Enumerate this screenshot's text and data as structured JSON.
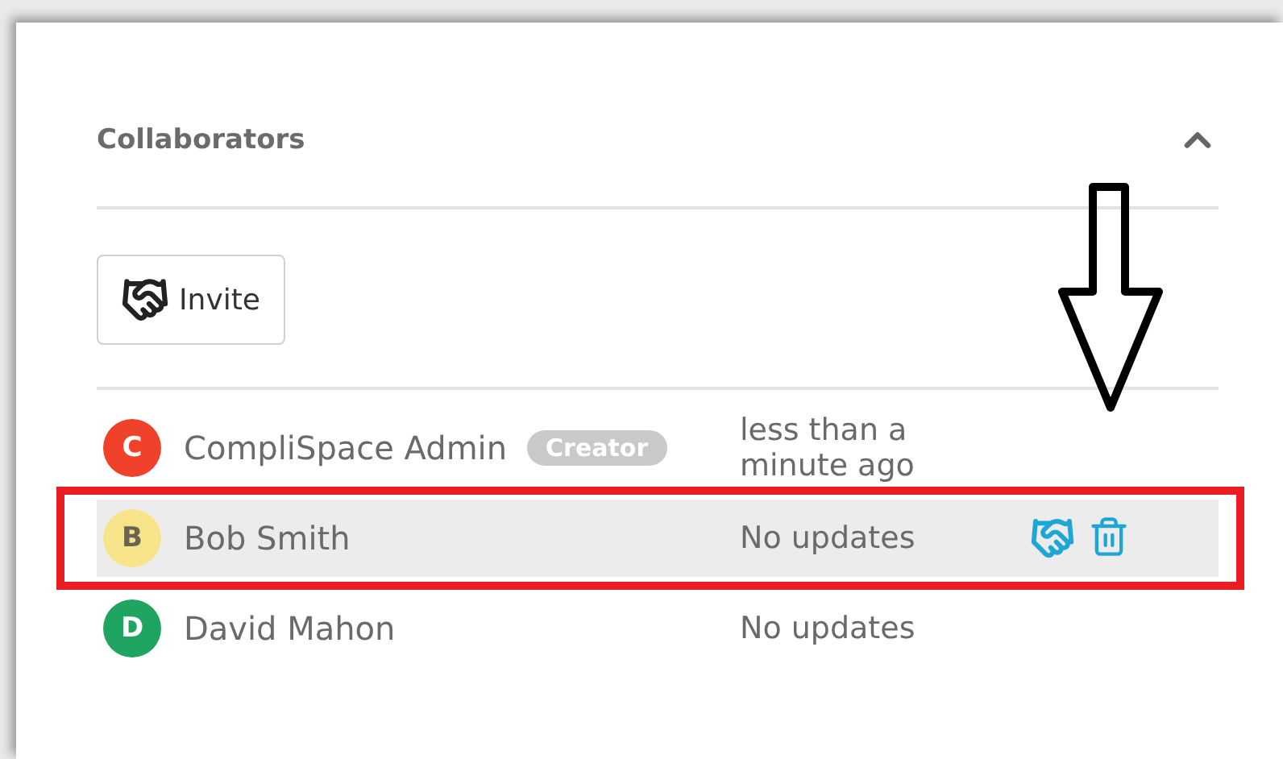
{
  "panel": {
    "title": "Collaborators",
    "expanded": true
  },
  "invite_button": {
    "label": "Invite"
  },
  "collaborators": [
    {
      "initial": "C",
      "name": "CompliSpace Admin",
      "color": "#f0412a",
      "badge": "Creator",
      "status": "less than a minute ago",
      "selected": false
    },
    {
      "initial": "B",
      "name": "Bob Smith",
      "color": "#f7e48a",
      "status": "No updates",
      "selected": true
    },
    {
      "initial": "D",
      "name": "David Mahon",
      "color": "#1fa462",
      "status": "No updates",
      "selected": false
    }
  ]
}
